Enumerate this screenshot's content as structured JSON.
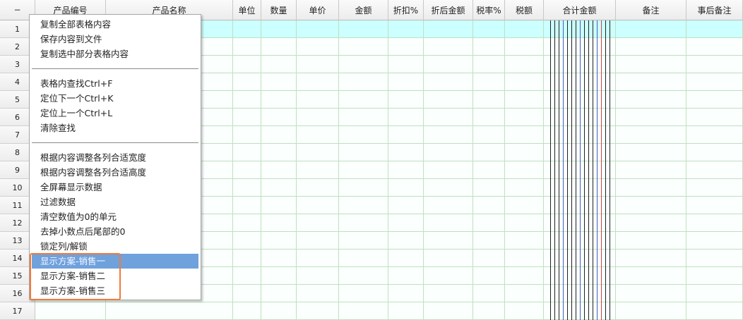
{
  "table": {
    "corner_label": "−",
    "columns": [
      "产品编号",
      "产品名称",
      "单位",
      "数量",
      "单价",
      "金额",
      "折扣%",
      "折后金额",
      "税率%",
      "税额",
      "合计金额",
      "备注",
      "事后备注"
    ],
    "row_numbers": [
      "1",
      "2",
      "3",
      "4",
      "5",
      "6",
      "7",
      "8",
      "9",
      "10",
      "11",
      "12",
      "13",
      "14",
      "15",
      "16",
      "17"
    ],
    "selected_row": "1"
  },
  "context_menu": {
    "groups": [
      [
        "复制全部表格内容",
        "保存内容到文件",
        "复制选中部分表格内容"
      ],
      [
        "表格内查找Ctrl+F",
        "定位下一个Ctrl+K",
        "定位上一个Ctrl+L",
        "清除查找"
      ],
      [
        "根据内容调整各列合适宽度",
        "根据内容调整各列合适高度",
        "全屏幕显示数据",
        "过滤数据",
        "清空数值为0的单元",
        "去掉小数点后尾部的0",
        "锁定列/解锁",
        "显示方案-销售一",
        "显示方案-销售二",
        "显示方案-销售三"
      ]
    ],
    "highlighted_item": "显示方案-销售一"
  },
  "colors": {
    "grid_line": "#bfe0bf",
    "selected_row": "#ccffff",
    "menu_highlight": "#6fa1dd",
    "focus_outline": "#f07a3a",
    "amount_line_red": "#d04040",
    "amount_line_blue": "#4060c0"
  }
}
